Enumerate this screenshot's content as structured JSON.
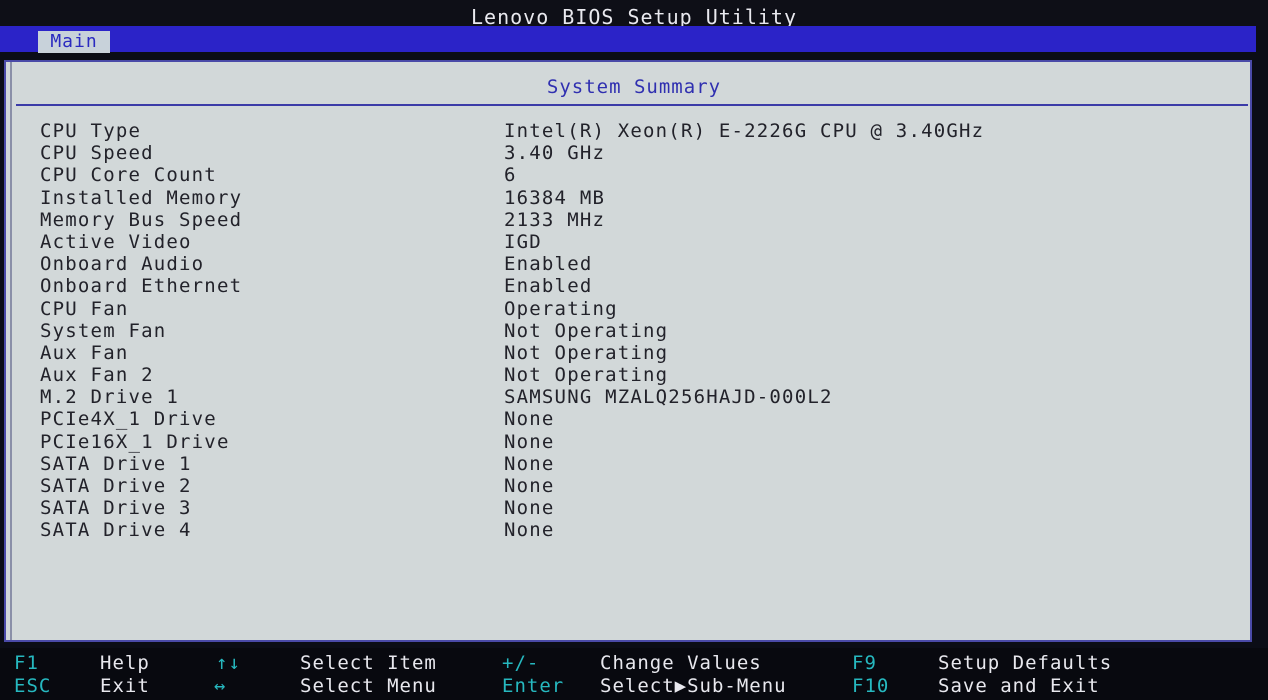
{
  "window": {
    "title": "Lenovo BIOS Setup Utility"
  },
  "menu": {
    "tabs": [
      {
        "label": "Main",
        "selected": true
      }
    ]
  },
  "section": {
    "title": "System Summary"
  },
  "summary": [
    {
      "label": "CPU Type",
      "value": "Intel(R) Xeon(R) E-2226G CPU @ 3.40GHz"
    },
    {
      "label": "CPU Speed",
      "value": "3.40 GHz"
    },
    {
      "label": "CPU Core Count",
      "value": "6"
    },
    {
      "label": "Installed Memory",
      "value": "16384 MB"
    },
    {
      "label": "Memory Bus Speed",
      "value": "2133 MHz"
    },
    {
      "label": "Active Video",
      "value": "IGD"
    },
    {
      "label": "Onboard Audio",
      "value": "Enabled"
    },
    {
      "label": "Onboard Ethernet",
      "value": "Enabled"
    },
    {
      "label": "CPU Fan",
      "value": "Operating"
    },
    {
      "label": "System Fan",
      "value": "Not Operating"
    },
    {
      "label": "Aux Fan",
      "value": "Not Operating"
    },
    {
      "label": "Aux Fan 2",
      "value": "Not Operating"
    },
    {
      "label": "M.2 Drive 1",
      "value": "SAMSUNG MZALQ256HAJD-000L2"
    },
    {
      "label": "PCIe4X_1 Drive",
      "value": "None"
    },
    {
      "label": "PCIe16X_1 Drive",
      "value": "None"
    },
    {
      "label": "SATA Drive 1",
      "value": "None"
    },
    {
      "label": "SATA Drive 2",
      "value": "None"
    },
    {
      "label": "SATA Drive 3",
      "value": "None"
    },
    {
      "label": "SATA Drive 4",
      "value": "None"
    }
  ],
  "footer": {
    "keys": [
      {
        "key": "F1",
        "action": "Help"
      },
      {
        "key": "ESC",
        "action": "Exit"
      },
      {
        "key": "↑↓",
        "action": "Select Item"
      },
      {
        "key": "↔",
        "action": "Select Menu"
      },
      {
        "key": "+/-",
        "action": "Change Values"
      },
      {
        "key": "Enter",
        "action": "Select▶Sub-Menu"
      },
      {
        "key": "F9",
        "action": "Setup Defaults"
      },
      {
        "key": "F10",
        "action": "Save and Exit"
      }
    ]
  },
  "colors": {
    "menu_bar": "#2b23c8",
    "panel_bg": "#d2d8d9",
    "section_title": "#2f2fb0",
    "footer_key": "#26b8bf",
    "footer_text": "#e8e8ee"
  }
}
